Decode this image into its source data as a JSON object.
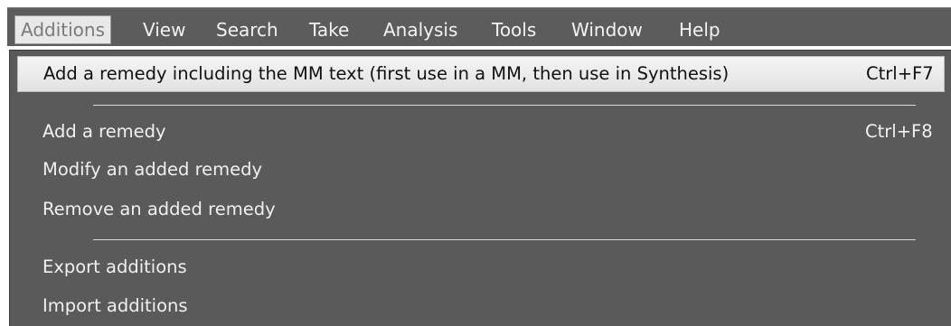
{
  "menubar": {
    "items": [
      {
        "label": "Additions"
      },
      {
        "label": "View"
      },
      {
        "label": "Search"
      },
      {
        "label": "Take"
      },
      {
        "label": "Analysis"
      },
      {
        "label": "Tools"
      },
      {
        "label": "Window"
      },
      {
        "label": "Help"
      }
    ]
  },
  "dropdown": {
    "items": [
      {
        "label": "Add a remedy including the MM text (first use in a MM, then use in Synthesis)",
        "shortcut": "Ctrl+F7"
      },
      {
        "label": "Add a remedy",
        "shortcut": "Ctrl+F8"
      },
      {
        "label": "Modify an added remedy"
      },
      {
        "label": "Remove an added remedy"
      },
      {
        "label": "Export additions"
      },
      {
        "label": "Import additions"
      }
    ]
  }
}
